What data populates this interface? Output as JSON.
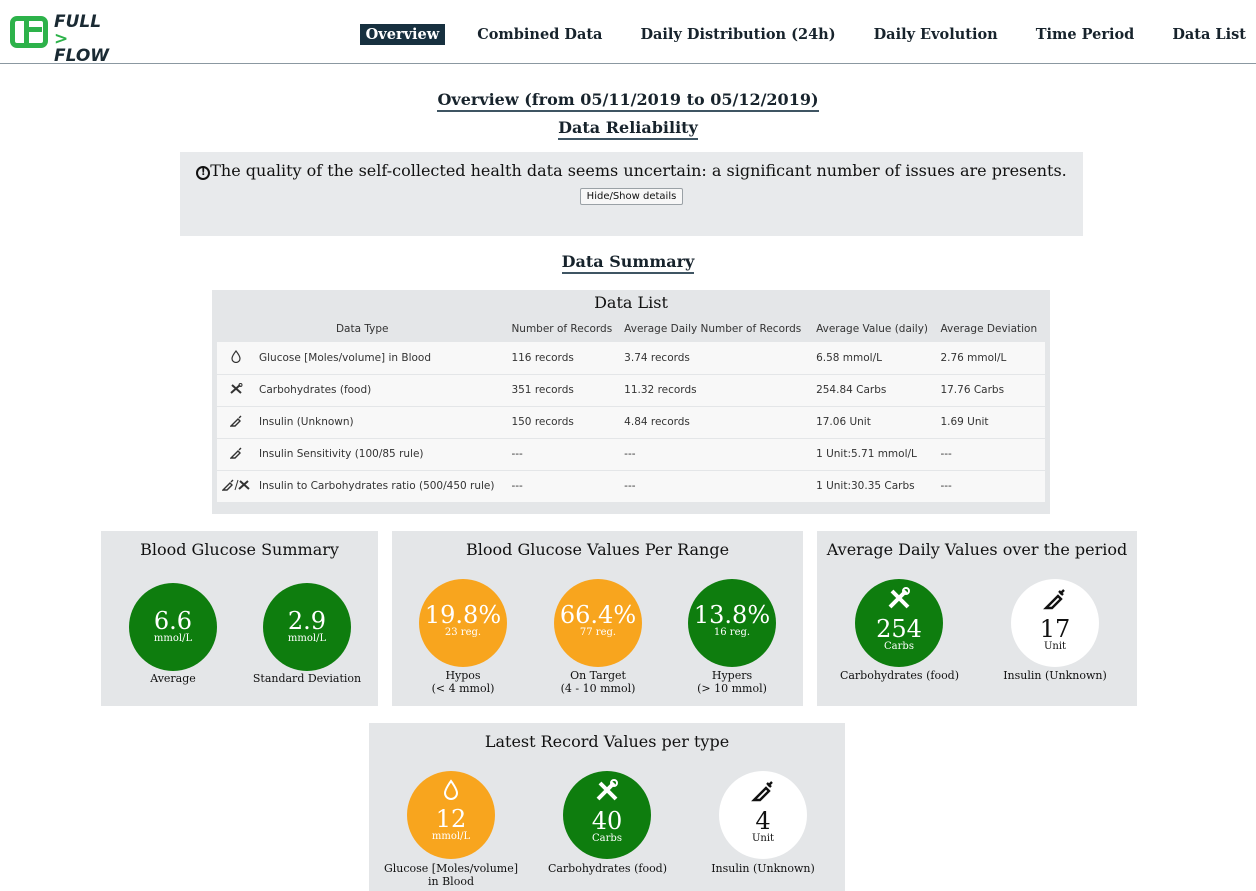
{
  "brand": {
    "line1": "FULL",
    "arrow": ">",
    "line2": "FLOW"
  },
  "nav": [
    "Overview",
    "Combined Data",
    "Daily Distribution (24h)",
    "Daily Evolution",
    "Time Period",
    "Data List"
  ],
  "page_title": "Overview (from 05/11/2019 to 05/12/2019)",
  "reliability": {
    "heading": "Data Reliability",
    "message": "The quality of the self-collected health data seems uncertain: a significant number of issues are presents.",
    "toggle_label": "Hide/Show details"
  },
  "summary_heading": "Data Summary",
  "data_list": {
    "title": "Data List",
    "headers": [
      "Data Type",
      "Number of Records",
      "Average Daily Number of Records",
      "Average Value (daily)",
      "Average Deviation"
    ],
    "rows": [
      {
        "icon": "drop-icon",
        "glyph": "💧",
        "type": "Glucose [Moles/volume] in Blood",
        "records": "116 records",
        "daily": "3.74 records",
        "value": "6.58 mmol/L",
        "dev": "2.76 mmol/L"
      },
      {
        "icon": "food-icon",
        "glyph": "✂",
        "type": "Carbohydrates (food)",
        "records": "351 records",
        "daily": "11.32 records",
        "value": "254.84 Carbs",
        "dev": "17.76 Carbs"
      },
      {
        "icon": "syringe-icon",
        "glyph": "✎",
        "type": "Insulin (Unknown)",
        "records": "150 records",
        "daily": "4.84 records",
        "value": "17.06 Unit",
        "dev": "1.69 Unit"
      },
      {
        "icon": "syringe-icon",
        "glyph": "✎",
        "type": "Insulin Sensitivity (100/85 rule)",
        "records": "---",
        "daily": "---",
        "value": "1 Unit:5.71 mmol/L",
        "dev": "---"
      },
      {
        "icon": "syringe-food-icon",
        "glyph": "✎/✂",
        "type": "Insulin to Carbohydrates ratio (500/450 rule)",
        "records": "---",
        "daily": "---",
        "value": "1 Unit:30.35 Carbs",
        "dev": "---"
      }
    ]
  },
  "bg_summary": {
    "title": "Blood Glucose Summary",
    "average": {
      "value": "6.6",
      "unit": "mmol/L",
      "label": "Average"
    },
    "std": {
      "value": "2.9",
      "unit": "mmol/L",
      "label": "Standard Deviation"
    }
  },
  "bg_range": {
    "title": "Blood Glucose Values Per Range",
    "hypos": {
      "value": "19.8%",
      "count": "23 reg.",
      "label": "Hypos",
      "range": "(< 4 mmol)"
    },
    "target": {
      "value": "66.4%",
      "count": "77 reg.",
      "label": "On Target",
      "range": "(4 - 10 mmol)"
    },
    "hypers": {
      "value": "13.8%",
      "count": "16 reg.",
      "label": "Hypers",
      "range": "(> 10 mmol)"
    }
  },
  "avg_daily": {
    "title": "Average Daily Values over the period",
    "carbs": {
      "value": "254",
      "unit": "Carbs",
      "label": "Carbohydrates (food)"
    },
    "insulin": {
      "value": "17",
      "unit": "Unit",
      "label": "Insulin (Unknown)"
    }
  },
  "latest": {
    "title": "Latest Record Values per type",
    "glucose": {
      "value": "12",
      "unit": "mmol/L",
      "label1": "Glucose [Moles/volume]",
      "label2": "in Blood"
    },
    "carbs": {
      "value": "40",
      "unit": "Carbs",
      "label": "Carbohydrates (food)"
    },
    "insulin": {
      "value": "4",
      "unit": "Unit",
      "label": "Insulin (Unknown)"
    }
  },
  "colors": {
    "green": "#0e7d0e",
    "orange": "#f8a51e",
    "nav_active": "#17303f",
    "panel": "#e4e6e8"
  }
}
